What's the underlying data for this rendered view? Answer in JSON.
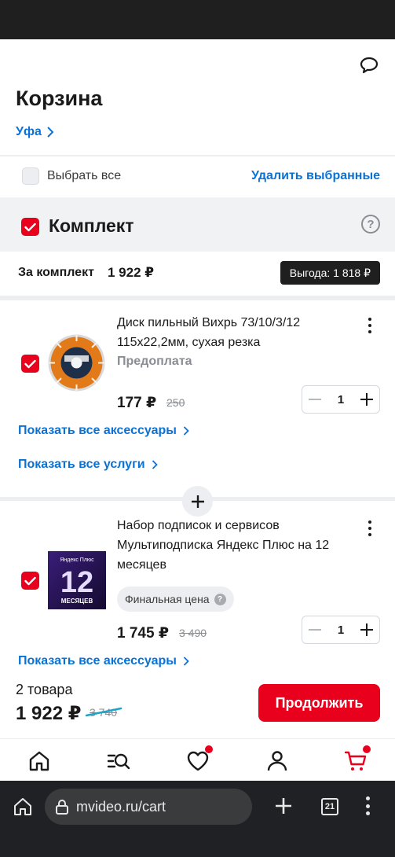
{
  "header": {
    "title": "Корзина",
    "city": "Уфа"
  },
  "selection": {
    "select_all_label": "Выбрать все",
    "delete_selected_label": "Удалить выбранные"
  },
  "kit": {
    "title": "Комплект",
    "help_glyph": "?",
    "total_label": "За комплект",
    "total_value": "1 922 ₽",
    "savings_badge": "Выгода: 1 818 ₽"
  },
  "items": [
    {
      "title": "Диск пильный Вихрь 73/10/3/12 115x22,2мм, сухая резка",
      "subtitle": "Предоплата",
      "price": "177 ₽",
      "old_price": "250",
      "quantity": "1",
      "links": [
        "Показать все аксессуары",
        "Показать все услуги"
      ]
    },
    {
      "title": "Набор подписок и сервисов Мультиподписка Яндекс Плюс на 12 месяцев",
      "chip": "Финальная цена",
      "chip_glyph": "?",
      "price": "1 745 ₽",
      "old_price": "3 490",
      "quantity": "1",
      "links": [
        "Показать все аксессуары"
      ],
      "image_text": {
        "brand": "Яндекс Плюс",
        "number": "12",
        "caption": "МЕСЯЦЕВ"
      }
    }
  ],
  "checkout": {
    "items_count": "2 товара",
    "total": "1 922 ₽",
    "old_total": "3 740",
    "continue_label": "Продолжить"
  },
  "bottom_nav": [
    "home-icon",
    "catalog-search-icon",
    "favorites-icon",
    "profile-icon",
    "cart-icon"
  ],
  "browser": {
    "url": "mvideo.ru/cart",
    "tabs_count": "21"
  },
  "colors": {
    "accent_red": "#e8001c",
    "link_blue": "#0a72d6",
    "dark": "#1f1f1f"
  }
}
